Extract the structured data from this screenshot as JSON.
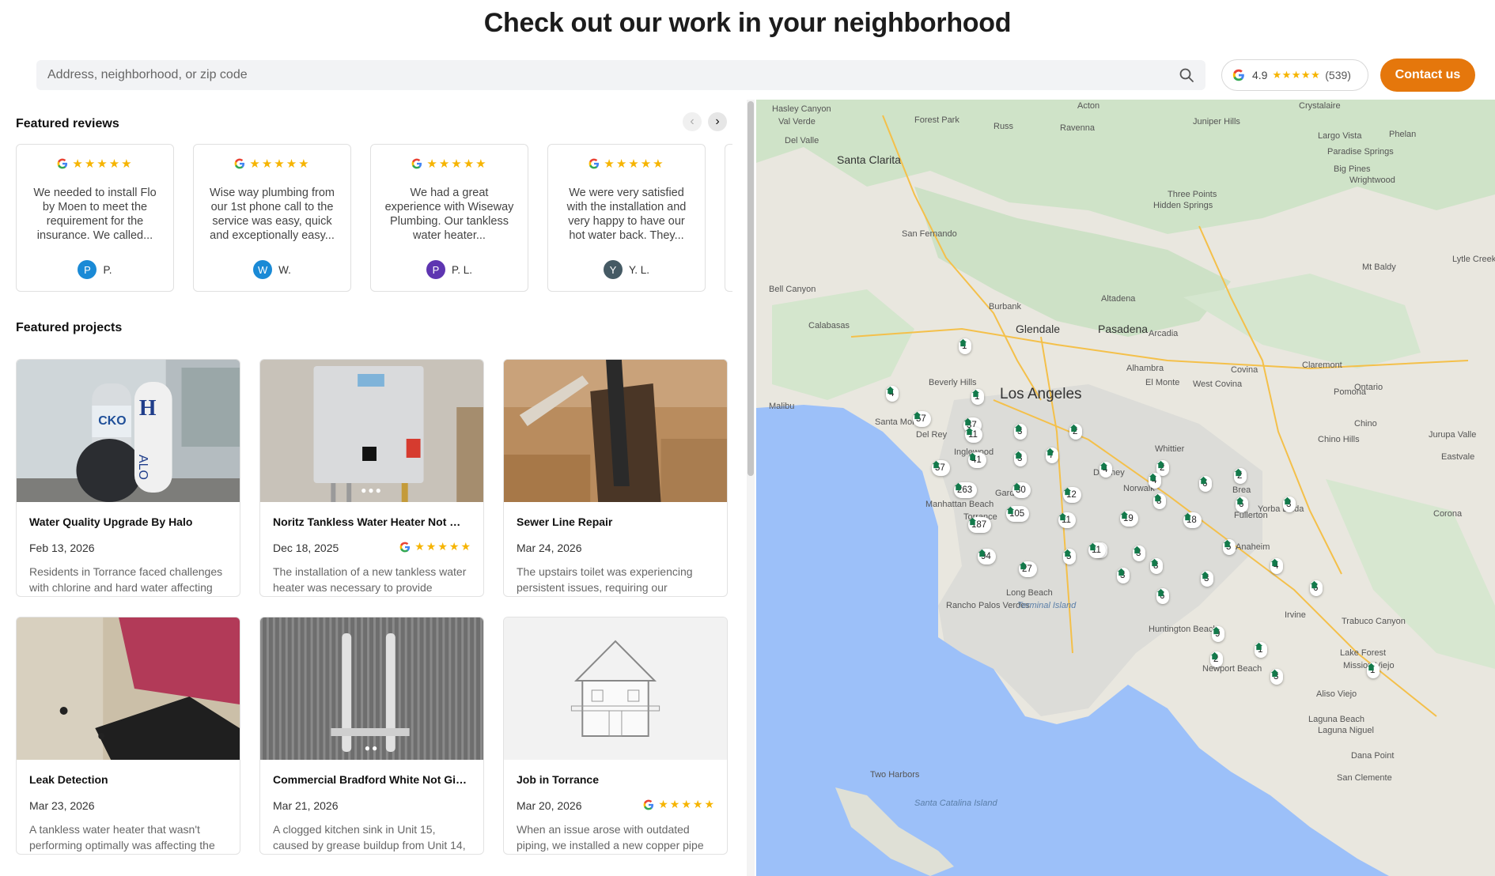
{
  "header": {
    "title": "Check out our work in your neighborhood",
    "search_placeholder": "Address, neighborhood, or zip code",
    "rating": {
      "score": "4.9",
      "stars": "★★★★★",
      "count": "(539)"
    },
    "contact_label": "Contact us"
  },
  "reviews": {
    "heading": "Featured reviews",
    "prev": "‹",
    "next": "›",
    "items": [
      {
        "stars": "★★★★★",
        "text": "We needed to install Flo by Moen to meet the requirement for the insurance. We called...",
        "initial": "P",
        "name": "P.",
        "avatar_color": "#1a8ad6"
      },
      {
        "stars": "★★★★★",
        "text": "Wise way plumbing from our 1st phone call to the service was easy, quick and exceptionally easy...",
        "initial": "W",
        "name": "W.",
        "avatar_color": "#1a8ad6"
      },
      {
        "stars": "★★★★★",
        "text": "We had a great experience with Wiseway Plumbing. Our tankless water heater...",
        "initial": "P",
        "name": "P. L.",
        "avatar_color": "#5e35b1"
      },
      {
        "stars": "★★★★★",
        "text": "We were very satisfied with the installation and very happy to have our hot water back. They...",
        "initial": "Y",
        "name": "Y. L.",
        "avatar_color": "#455a64"
      }
    ]
  },
  "projects": {
    "heading": "Featured projects",
    "items": [
      {
        "title": "Water Quality Upgrade By Halo",
        "date": "Feb 13, 2026",
        "desc": "Residents in Torrance faced challenges with chlorine and hard water affecting",
        "stars": ""
      },
      {
        "title": "Noritz Tankless Water Heater Not Wor...",
        "date": "Dec 18, 2025",
        "desc": "The installation of a new tankless water heater was necessary to provide",
        "stars": "★★★★★",
        "dots": "●●●"
      },
      {
        "title": "Sewer Line Repair",
        "date": "Mar 24, 2026",
        "desc": "The upstairs toilet was experiencing persistent issues, requiring our",
        "stars": ""
      },
      {
        "title": "Leak Detection",
        "date": "Mar 23, 2026",
        "desc": "A tankless water heater that wasn't performing optimally was affecting the",
        "stars": ""
      },
      {
        "title": "Commercial Bradford White Not Givin...",
        "date": "Mar 21, 2026",
        "desc": "A clogged kitchen sink in Unit 15, caused by grease buildup from Unit 14,",
        "stars": "",
        "dots": "●●"
      },
      {
        "title": "Job in Torrance",
        "date": "Mar 20, 2026",
        "desc": "When an issue arose with outdated piping, we installed a new copper pipe",
        "stars": "★★★★★"
      }
    ]
  },
  "map": {
    "places": [
      "Hasley Canyon",
      "Val Verde",
      "Del Valle",
      "Forest Park",
      "Russ",
      "Acton",
      "Ravenna",
      "Juniper Hills",
      "Crystalaire",
      "Santa Clarita",
      "Largo Vista",
      "Phelan",
      "Paradise Springs",
      "Big Pines",
      "Wrightwood",
      "Three Points",
      "Hidden Springs",
      "San Fernando",
      "Lytle Creek",
      "Mt Baldy",
      "Bell Canyon",
      "Burbank",
      "Altadena",
      "Calabasas",
      "Glendale",
      "Pasadena",
      "Arcadia",
      "Claremont",
      "Beverly Hills",
      "Alhambra",
      "El Monte",
      "West Covina",
      "Covina",
      "Ontario",
      "Pomona",
      "Los Angeles",
      "Malibu",
      "Santa Monica",
      "Chino",
      "Chino Hills",
      "Jurupa Valle",
      "Del Rey",
      "Inglewood",
      "Whittier",
      "Eastvale",
      "Downey",
      "Norwalk",
      "Brea",
      "Yorba Linda",
      "Manhattan Beach",
      "Fullerton",
      "Corona",
      "Gardena",
      "Torrance",
      "Anaheim",
      "Long Beach",
      "Rancho Palos Verdes",
      "Terminal Island",
      "Irvine",
      "Trabuco Canyon",
      "Huntington Beach",
      "Lake Forest",
      "Newport Beach",
      "Mission Viejo",
      "Aliso Viejo",
      "Laguna Beach",
      "Laguna Niguel",
      "Dana Point",
      "San Clemente",
      "Two Harbors",
      "Santa Catalina Island"
    ],
    "markers": [
      "1",
      "1",
      "4",
      "57",
      "37",
      "11",
      "3",
      "2",
      "3",
      "41",
      "7",
      "57",
      "263",
      "30",
      "4",
      "2",
      "12",
      "6",
      "2",
      "4",
      "105",
      "11",
      "19",
      "8",
      "6",
      "3",
      "187",
      "18",
      "3",
      "94",
      "5",
      "27",
      "11",
      "3",
      "5",
      "8",
      "4",
      "3",
      "3",
      "6",
      "6",
      "9",
      "1",
      "2",
      "1",
      "3"
    ]
  },
  "colors": {
    "accent": "#e5770c",
    "star": "#f6b400",
    "marker_green": "#137a4b",
    "water": "#9cc0f9"
  }
}
